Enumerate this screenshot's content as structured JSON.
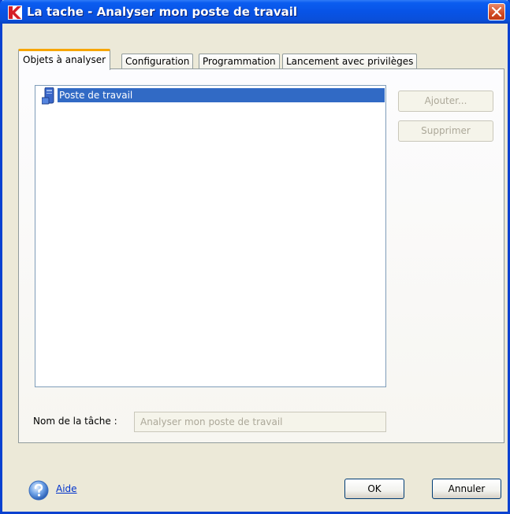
{
  "window": {
    "title": "La tache - Analyser mon poste de travail"
  },
  "tabs": [
    {
      "label": "Objets à analyser",
      "active": true
    },
    {
      "label": "Configuration",
      "active": false
    },
    {
      "label": "Programmation",
      "active": false
    },
    {
      "label": "Lancement avec privilèges",
      "active": false
    }
  ],
  "objects": {
    "items": [
      {
        "label": "Poste de travail",
        "selected": true,
        "icon": "computer-icon"
      }
    ],
    "add_label": "Ajouter...",
    "remove_label": "Supprimer"
  },
  "task_name": {
    "label": "Nom de la tâche :",
    "value": "Analyser mon poste de travail"
  },
  "footer": {
    "help_label": "Aide",
    "ok_label": "OK",
    "cancel_label": "Annuler"
  },
  "colors": {
    "titlebar": "#0853e6",
    "selection": "#316ac5",
    "active_tab_accent": "#f7a500",
    "close_button": "#d24a22"
  }
}
